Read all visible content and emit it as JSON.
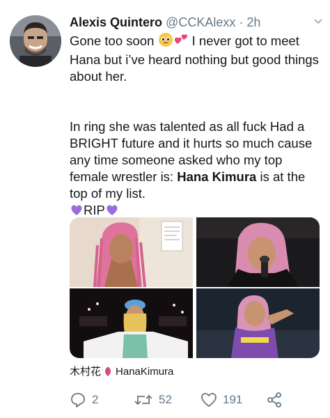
{
  "tweet": {
    "display_name": "Alexis Quintero",
    "handle": "@CCKAlexx",
    "separator": "·",
    "time": "2h",
    "line1_a": "Gone too soon ",
    "line1_b": " I never got to meet Hana but i’ve heard nothing but good things about her.",
    "para2_a": "In ring she was talented as all fuck Had a BRIGHT future and it hurts so much cause any time someone asked who my top female wrestler is: ",
    "para2_bold": "Hana Kimura",
    "para2_b": " is at the top of my list.",
    "rip_text": "RIP",
    "tag_prefix": "木村花",
    "tag_name": "HanaKimura",
    "replies": "2",
    "retweets": "52",
    "likes": "191"
  },
  "icons": {
    "caret": "chevron-down-icon",
    "reply": "reply-icon",
    "retweet": "retweet-icon",
    "like": "heart-icon",
    "share": "share-icon",
    "tag": "person-tag-icon"
  },
  "colors": {
    "name": "#14171a",
    "muted": "#657786",
    "purple_heart": "#9b6ddb",
    "pink_heart": "#e8457a"
  }
}
